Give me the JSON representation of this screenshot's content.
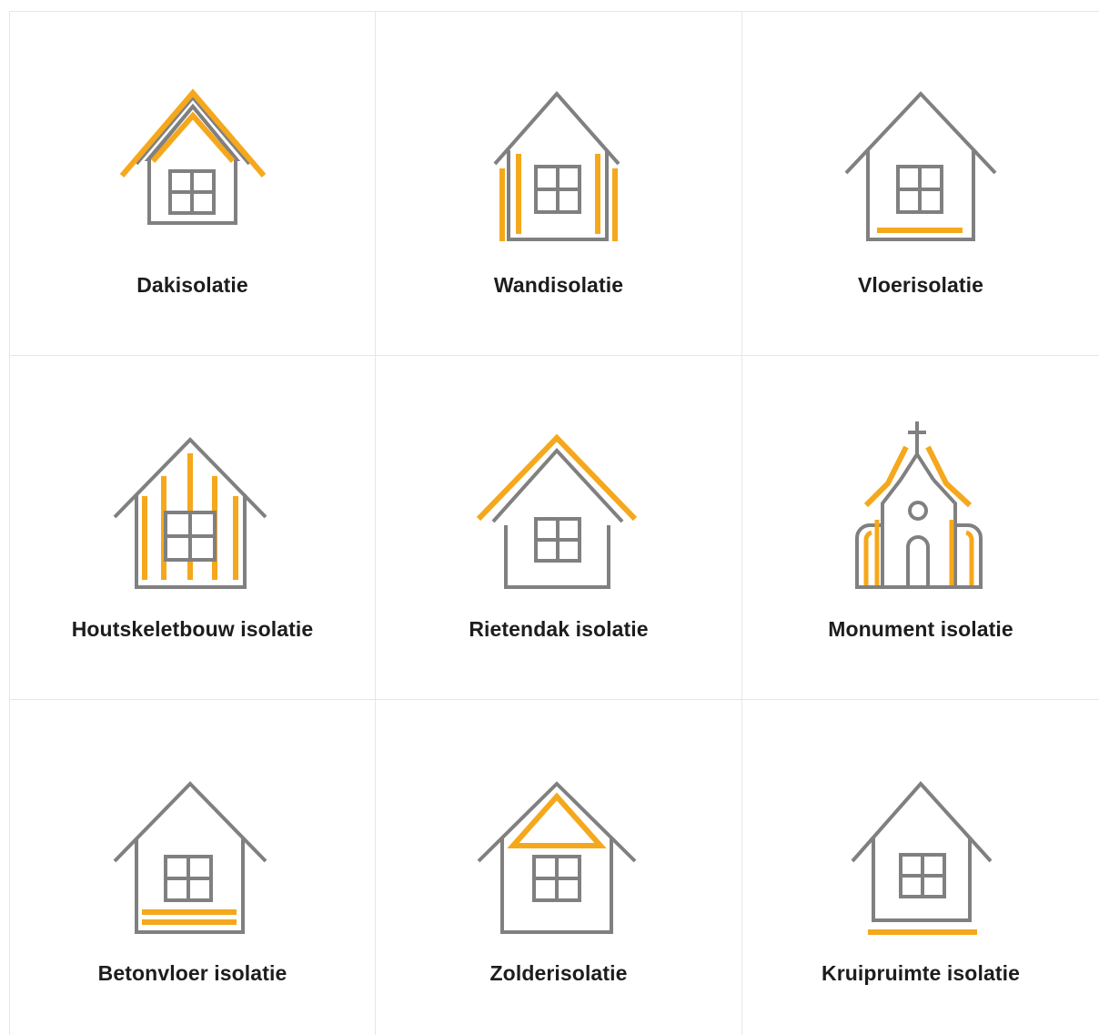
{
  "colors": {
    "outline": "#808080",
    "accent": "#f5a81c",
    "divider": "#e6e6e6",
    "text": "#1d1d1d"
  },
  "tiles": [
    {
      "label": "Dakisolatie",
      "icon": "roof-insulation-icon"
    },
    {
      "label": "Wandisolatie",
      "icon": "wall-insulation-icon"
    },
    {
      "label": "Vloerisolatie",
      "icon": "floor-insulation-icon"
    },
    {
      "label": "Houtskeletbouw isolatie",
      "icon": "timber-frame-insulation-icon"
    },
    {
      "label": "Rietendak isolatie",
      "icon": "thatched-roof-insulation-icon"
    },
    {
      "label": "Monument isolatie",
      "icon": "monument-church-icon"
    },
    {
      "label": "Betonvloer isolatie",
      "icon": "concrete-floor-insulation-icon"
    },
    {
      "label": "Zolderisolatie",
      "icon": "attic-insulation-icon"
    },
    {
      "label": "Kruipruimte isolatie",
      "icon": "crawlspace-insulation-icon"
    }
  ]
}
